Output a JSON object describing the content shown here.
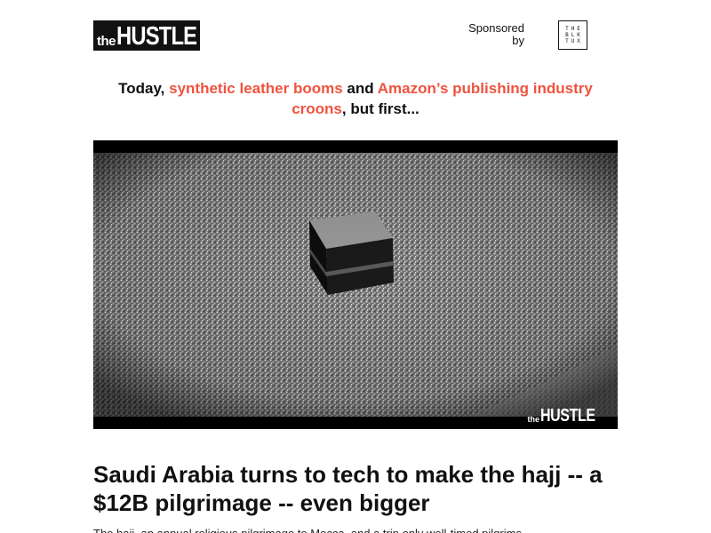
{
  "header": {
    "logo": {
      "prefix": "the",
      "name": "HUSTLE"
    },
    "sponsor": {
      "label_line1": "Sponsored",
      "label_line2": "by",
      "logo_lines": [
        "THE",
        "BLK",
        "TUX"
      ]
    }
  },
  "teaser": {
    "lead": "Today,",
    "link1": "synthetic leather booms",
    "connector": "and",
    "link2": "Amazon’s publishing industry croons",
    "trail": ", but first..."
  },
  "hero": {
    "watermark_prefix": "the",
    "watermark_name": "HUSTLE"
  },
  "article": {
    "headline": "Saudi Arabia turns to tech to make the hajj -- a $12B pilgrimage -- even bigger",
    "body_start": "The hajj, an annual religious pilgrimage to Mecca, and a trip only well-timed pilgrims"
  },
  "colors": {
    "accent": "#f0533f",
    "text": "#111111",
    "background": "#ffffff"
  }
}
